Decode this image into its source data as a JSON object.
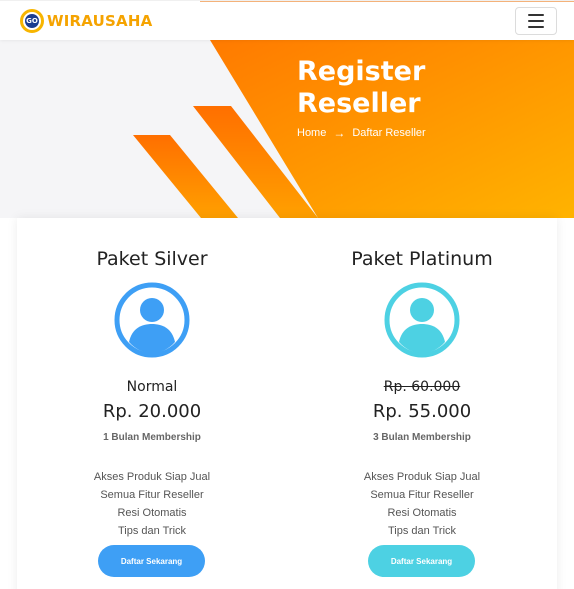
{
  "header": {
    "logo_badge_text": "GO",
    "logo_text": "WIRAUSAHA",
    "menu_icon": "hamburger-icon"
  },
  "hero": {
    "title": "Register Reseller",
    "breadcrumb": {
      "home": "Home",
      "separator_icon": "arrow-right-icon",
      "current": "Daftar Reseller"
    }
  },
  "plans": [
    {
      "name": "Paket Silver",
      "avatar_icon": "user-avatar-icon",
      "tier": "Normal",
      "price": "Rp. 20.000",
      "membership": "1 Bulan Membership",
      "features": [
        "Akses Produk Siap Jual",
        "Semua Fitur Reseller",
        "Resi Otomatis",
        "Tips dan Trick"
      ],
      "cta_label": "Daftar Sekarang",
      "accent_color": "#3e9ff5"
    },
    {
      "name": "Paket Platinum",
      "avatar_icon": "user-avatar-icon",
      "tier": "Rp. 60.000",
      "price": "Rp. 55.000",
      "membership": "3 Bulan Membership",
      "features": [
        "Akses Produk Siap Jual",
        "Semua Fitur Reseller",
        "Resi Otomatis",
        "Tips dan Trick"
      ],
      "cta_label": "Daftar Sekarang",
      "accent_color": "#4dd1e3"
    }
  ],
  "colors": {
    "brand_orange": "#ff8a00",
    "brand_yellow": "#f7b500",
    "silver_accent": "#3e9ff5",
    "platinum_accent": "#4dd1e3"
  }
}
